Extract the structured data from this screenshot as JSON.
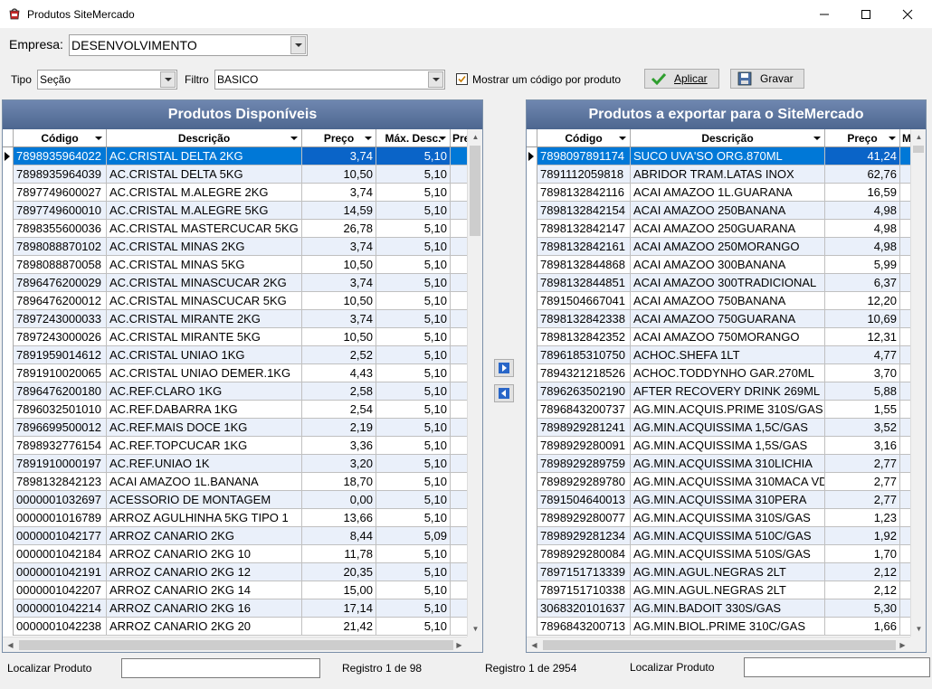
{
  "window": {
    "title": "Produtos SiteMercado"
  },
  "empresa": {
    "label": "Empresa:",
    "value": "DESENVOLVIMENTO"
  },
  "tipo": {
    "label": "Tipo",
    "value": "Seção"
  },
  "filtro": {
    "label": "Filtro",
    "value": "BASICO"
  },
  "mostrar": {
    "label": "Mostrar um código por produto",
    "checked": true
  },
  "buttons": {
    "aplicar": "Aplicar",
    "gravar": "Gravar"
  },
  "left": {
    "title": "Produtos Disponíveis",
    "columns": [
      "Código",
      "Descrição",
      "Preço",
      "Máx. Desc.",
      "Pre"
    ],
    "rows": [
      [
        "7898935964022",
        "AC.CRISTAL DELTA 2KG",
        "3,74",
        "5,10"
      ],
      [
        "7898935964039",
        "AC.CRISTAL DELTA 5KG",
        "10,50",
        "5,10"
      ],
      [
        "7897749600027",
        "AC.CRISTAL M.ALEGRE 2KG",
        "3,74",
        "5,10"
      ],
      [
        "7897749600010",
        "AC.CRISTAL M.ALEGRE 5KG",
        "14,59",
        "5,10"
      ],
      [
        "7898355600036",
        "AC.CRISTAL MASTERCUCAR 5KG",
        "26,78",
        "5,10"
      ],
      [
        "7898088870102",
        "AC.CRISTAL MINAS 2KG",
        "3,74",
        "5,10"
      ],
      [
        "7898088870058",
        "AC.CRISTAL MINAS 5KG",
        "10,50",
        "5,10"
      ],
      [
        "7896476200029",
        "AC.CRISTAL MINASCUCAR 2KG",
        "3,74",
        "5,10"
      ],
      [
        "7896476200012",
        "AC.CRISTAL MINASCUCAR 5KG",
        "10,50",
        "5,10"
      ],
      [
        "7897243000033",
        "AC.CRISTAL MIRANTE 2KG",
        "3,74",
        "5,10"
      ],
      [
        "7897243000026",
        "AC.CRISTAL MIRANTE 5KG",
        "10,50",
        "5,10"
      ],
      [
        "7891959014612",
        "AC.CRISTAL UNIAO 1KG",
        "2,52",
        "5,10"
      ],
      [
        "7891910020065",
        "AC.CRISTAL UNIAO DEMER.1KG",
        "4,43",
        "5,10"
      ],
      [
        "7896476200180",
        "AC.REF.CLARO 1KG",
        "2,58",
        "5,10"
      ],
      [
        "7896032501010",
        "AC.REF.DABARRA 1KG",
        "2,54",
        "5,10"
      ],
      [
        "7896699500012",
        "AC.REF.MAIS DOCE 1KG",
        "2,19",
        "5,10"
      ],
      [
        "7898932776154",
        "AC.REF.TOPCUCAR 1KG",
        "3,36",
        "5,10"
      ],
      [
        "7891910000197",
        "AC.REF.UNIAO 1K",
        "3,20",
        "5,10"
      ],
      [
        "7898132842123",
        "ACAI AMAZOO 1L.BANANA",
        "18,70",
        "5,10"
      ],
      [
        "0000001032697",
        "ACESSORIO DE MONTAGEM",
        "0,00",
        "5,10"
      ],
      [
        "0000001016789",
        "ARROZ AGULHINHA 5KG TIPO 1",
        "13,66",
        "5,10"
      ],
      [
        "0000001042177",
        "ARROZ CANARIO 2KG",
        "8,44",
        "5,09"
      ],
      [
        "0000001042184",
        "ARROZ CANARIO 2KG 10",
        "11,78",
        "5,10"
      ],
      [
        "0000001042191",
        "ARROZ CANARIO 2KG 12",
        "20,35",
        "5,10"
      ],
      [
        "0000001042207",
        "ARROZ CANARIO 2KG 14",
        "15,00",
        "5,10"
      ],
      [
        "0000001042214",
        "ARROZ CANARIO 2KG 16",
        "17,14",
        "5,10"
      ],
      [
        "0000001042238",
        "ARROZ CANARIO 2KG 20",
        "21,42",
        "5,10"
      ]
    ]
  },
  "right": {
    "title": "Produtos a exportar para o SiteMercado",
    "columns": [
      "Código",
      "Descrição",
      "Preço",
      "M"
    ],
    "rows": [
      [
        "7898097891174",
        "SUCO UVA'SO ORG.870ML",
        "41,24"
      ],
      [
        "7891112059818",
        "ABRIDOR TRAM.LATAS INOX",
        "62,76"
      ],
      [
        "7898132842116",
        "ACAI AMAZOO 1L.GUARANA",
        "16,59"
      ],
      [
        "7898132842154",
        "ACAI AMAZOO 250BANANA",
        "4,98"
      ],
      [
        "7898132842147",
        "ACAI AMAZOO 250GUARANA",
        "4,98"
      ],
      [
        "7898132842161",
        "ACAI AMAZOO 250MORANGO",
        "4,98"
      ],
      [
        "7898132844868",
        "ACAI AMAZOO 300BANANA",
        "5,99"
      ],
      [
        "7898132844851",
        "ACAI AMAZOO 300TRADICIONAL",
        "6,37"
      ],
      [
        "7891504667041",
        "ACAI AMAZOO 750BANANA",
        "12,20"
      ],
      [
        "7898132842338",
        "ACAI AMAZOO 750GUARANA",
        "10,69"
      ],
      [
        "7898132842352",
        "ACAI AMAZOO 750MORANGO",
        "12,31"
      ],
      [
        "7896185310750",
        "ACHOC.SHEFA 1LT",
        "4,77"
      ],
      [
        "7894321218526",
        "ACHOC.TODDYNHO GAR.270ML",
        "3,70"
      ],
      [
        "7896263502190",
        "AFTER RECOVERY DRINK 269ML",
        "5,88"
      ],
      [
        "7896843200737",
        "AG.MIN.ACQUIS.PRIME 310S/GAS",
        "1,55"
      ],
      [
        "7898929281241",
        "AG.MIN.ACQUISSIMA 1,5C/GAS",
        "3,52"
      ],
      [
        "7898929280091",
        "AG.MIN.ACQUISSIMA 1,5S/GAS",
        "3,16"
      ],
      [
        "7898929289759",
        "AG.MIN.ACQUISSIMA 310LICHIA",
        "2,77"
      ],
      [
        "7898929289780",
        "AG.MIN.ACQUISSIMA 310MACA VD",
        "2,77"
      ],
      [
        "7891504640013",
        "AG.MIN.ACQUISSIMA 310PERA",
        "2,77"
      ],
      [
        "7898929280077",
        "AG.MIN.ACQUISSIMA 310S/GAS",
        "1,23"
      ],
      [
        "7898929281234",
        "AG.MIN.ACQUISSIMA 510C/GAS",
        "1,92"
      ],
      [
        "7898929280084",
        "AG.MIN.ACQUISSIMA 510S/GAS",
        "1,70"
      ],
      [
        "7897151713339",
        "AG.MIN.AGUL.NEGRAS 2LT",
        "2,12"
      ],
      [
        "7897151710338",
        "AG.MIN.AGUL.NEGRAS 2LT",
        "2,12"
      ],
      [
        "3068320101637",
        "AG.MIN.BADOIT 330S/GAS",
        "5,30"
      ],
      [
        "7896843200713",
        "AG.MIN.BIOL.PRIME 310C/GAS",
        "1,66"
      ]
    ]
  },
  "footer": {
    "localizar_left": "Localizar Produto",
    "registro_left": "Registro 1 de 98",
    "registro_right": "Registro 1 de 2954",
    "localizar_right": "Localizar Produto"
  },
  "colors": {
    "header": "#4d6790",
    "selected": "#0078d7",
    "alt_row": "#eaf0fa"
  }
}
